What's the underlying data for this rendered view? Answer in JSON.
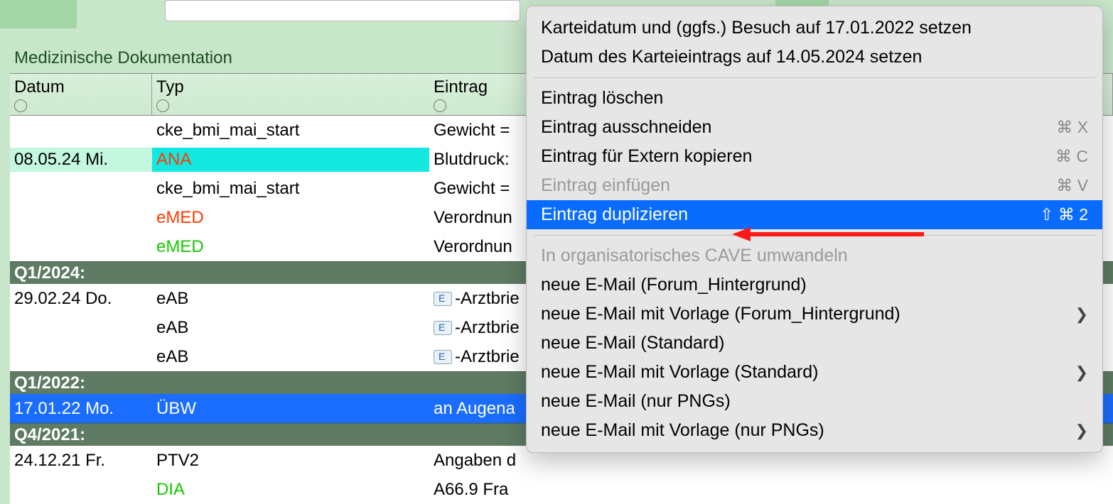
{
  "section_title": "Medizinische Dokumentation",
  "columns": {
    "date": "Datum",
    "type": "Typ",
    "entry": "Eintrag"
  },
  "rows": [
    {
      "date": "",
      "typ": "cke_bmi_mai_start",
      "typcls": "typ-black",
      "entry": "Gewicht ="
    },
    {
      "date": "08.05.24  Mi.",
      "typ": "ANA",
      "typcls": "typ-red",
      "entry": "Blutdruck:",
      "ana": true
    },
    {
      "date": "",
      "typ": "cke_bmi_mai_start",
      "typcls": "typ-black",
      "entry": "Gewicht ="
    },
    {
      "date": "",
      "typ": "eMED",
      "typcls": "typ-red",
      "entry": "Verordnun"
    },
    {
      "date": "",
      "typ": "eMED",
      "typcls": "typ-green",
      "entry": "Verordnun"
    }
  ],
  "sep1": "Q1/2024:",
  "rows2": [
    {
      "date": "29.02.24  Do.",
      "typ": "eAB",
      "typcls": "typ-black",
      "entry": "-Arztbrie",
      "env": true
    },
    {
      "date": "",
      "typ": "eAB",
      "typcls": "typ-black",
      "entry": "-Arztbrie",
      "env": true
    },
    {
      "date": "",
      "typ": "eAB",
      "typcls": "typ-black",
      "entry": "-Arztbrie",
      "env": true
    }
  ],
  "sep2": "Q1/2022:",
  "selrow": {
    "date": "17.01.22  Mo.",
    "typ": "ÜBW",
    "entry": "an Augena"
  },
  "sep3": "Q4/2021:",
  "rows3": [
    {
      "date": "24.12.21  Fr.",
      "typ": "PTV2",
      "typcls": "typ-black",
      "entry": "Angaben d"
    },
    {
      "date": "",
      "typ": "DIA",
      "typcls": "typ-green",
      "entry": "A66.9 Fra"
    }
  ],
  "menu": {
    "item1": "Karteidatum und (ggfs.) Besuch auf 17.01.2022 setzen",
    "item2": "Datum des Karteieintrags auf 14.05.2024 setzen",
    "item3": "Eintrag löschen",
    "item4": "Eintrag ausschneiden",
    "item4sc": "⌘ X",
    "item5": "Eintrag für Extern kopieren",
    "item5sc": "⌘ C",
    "item6": "Eintrag einfügen",
    "item6sc": "⌘ V",
    "item7": "Eintrag duplizieren",
    "item7sc": "⇧ ⌘ 2",
    "item8": "In organisatorisches CAVE umwandeln",
    "item9": "neue E-Mail (Forum_Hintergrund)",
    "item10": "neue E-Mail mit Vorlage (Forum_Hintergrund)",
    "item11": "neue E-Mail (Standard)",
    "item12": "neue E-Mail mit Vorlage (Standard)",
    "item13": "neue E-Mail (nur PNGs)",
    "item14": "neue E-Mail mit Vorlage (nur PNGs)"
  }
}
